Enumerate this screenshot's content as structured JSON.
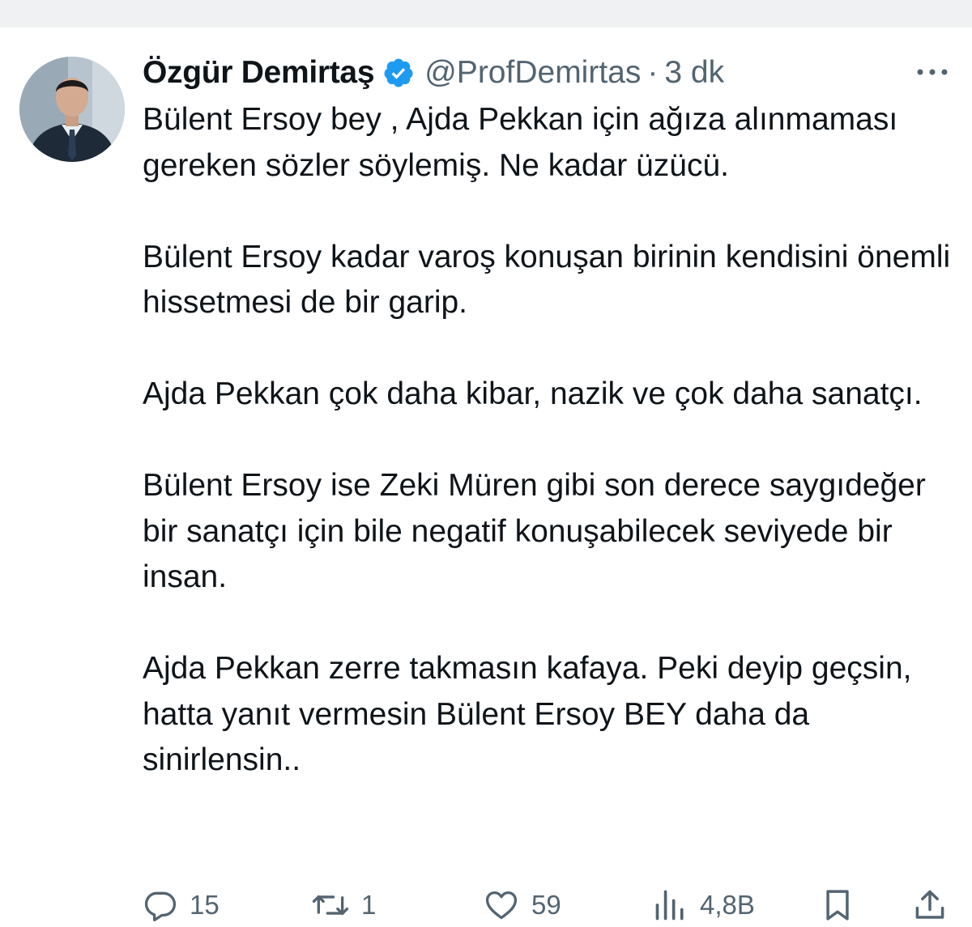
{
  "tweet": {
    "author": {
      "display_name": "Özgür Demirtaş",
      "handle": "@ProfDemirtas",
      "verified": true,
      "avatar_icon": "profile-photo-avatar"
    },
    "separator": "·",
    "time": "3 dk",
    "paragraphs": [
      "Bülent Ersoy bey , Ajda Pekkan için ağıza alınmaması gereken sözler söylemiş. Ne kadar üzücü.",
      "Bülent Ersoy kadar varoş konuşan birinin kendisini önemli hissetmesi de bir garip.",
      "Ajda Pekkan çok daha kibar, nazik ve çok daha sanatçı.",
      "Bülent Ersoy ise Zeki Müren gibi son derece saygıdeğer bir sanatçı için bile negatif konuşabilecek seviyede bir insan.",
      "Ajda Pekkan zerre takmasın kafaya. Peki deyip geçsin, hatta yanıt vermesin Bülent Ersoy BEY daha da sinirlensin.."
    ],
    "actions": {
      "reply": {
        "icon": "reply-icon",
        "count": "15"
      },
      "retweet": {
        "icon": "retweet-icon",
        "count": "1"
      },
      "like": {
        "icon": "heart-icon",
        "count": "59"
      },
      "views": {
        "icon": "views-icon",
        "count": "4,8B"
      },
      "bookmark": {
        "icon": "bookmark-icon"
      },
      "share": {
        "icon": "share-icon"
      },
      "more": {
        "icon": "more-icon"
      }
    }
  },
  "colors": {
    "text": "#0f1419",
    "secondary_text": "#536471",
    "verified_blue": "#1d9bf0",
    "top_strip": "#eff1f2",
    "background": "#ffffff"
  }
}
